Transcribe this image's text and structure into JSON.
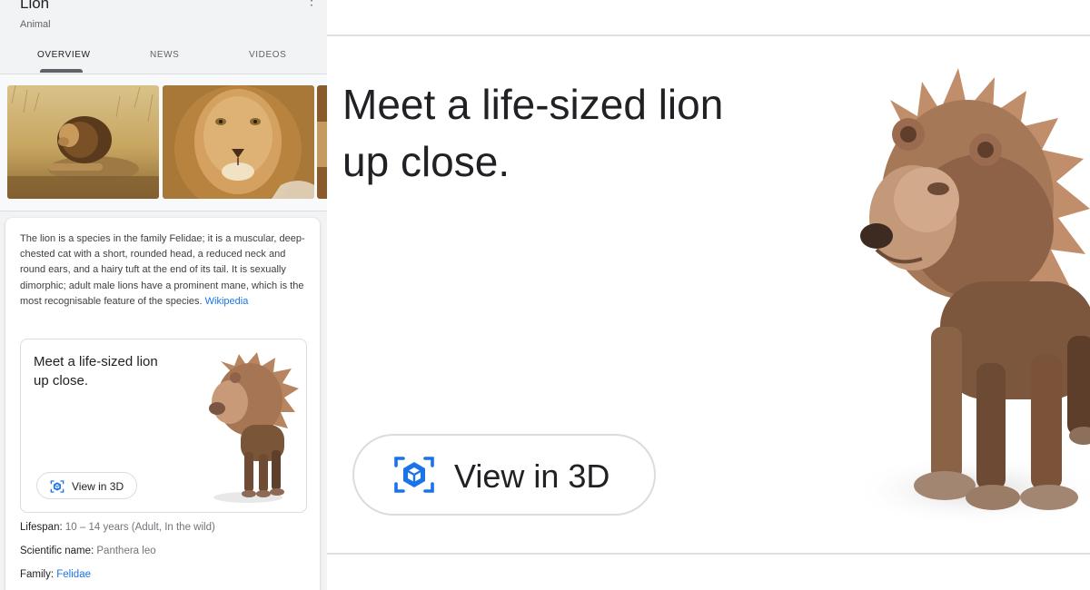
{
  "knowledge_panel": {
    "title": "Lion",
    "subtitle": "Animal",
    "more_icon": "more-vert-icon",
    "tabs": [
      {
        "label": "OVERVIEW",
        "selected": true
      },
      {
        "label": "NEWS",
        "selected": false
      },
      {
        "label": "VIDEOS",
        "selected": false
      }
    ]
  },
  "description": {
    "text": "The lion is a species in the family Felidae; it is a muscular, deep-chested cat with a short, rounded head, a reduced neck and round ears, and a hairy tuft at the end of its tail. It is sexually dimorphic; adult male lions have a prominent mane, which is the most recognisable feature of the species.",
    "source_link": "Wikipedia"
  },
  "ar_card": {
    "heading": "Meet a life-sized lion up close.",
    "button_label": "View in 3D",
    "button_icon": "ar-cube-icon"
  },
  "facts": [
    {
      "label": "Lifespan:",
      "value": "10 – 14 years (Adult, In the wild)"
    },
    {
      "label": "Scientific name:",
      "value": "Panthera leo"
    },
    {
      "label": "Family:",
      "value": "Felidae"
    }
  ],
  "zoom_panel": {
    "heading": "Meet a life-sized lion up close.",
    "button_label": "View in 3D"
  },
  "colors": {
    "link": "#1a73e8",
    "ar_icon": "#1a73e8",
    "text_primary": "#202124",
    "text_secondary": "#70757a"
  }
}
